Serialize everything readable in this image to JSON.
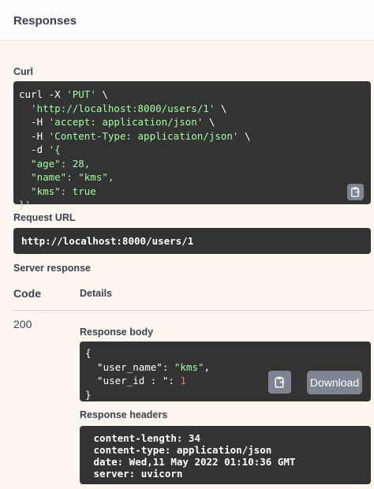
{
  "section_title": "Responses",
  "curl": {
    "label": "Curl",
    "line1_cmd": "curl -X ",
    "line1_method": "'PUT'",
    "line1_tail": " \\",
    "line2_url": "'http://localhost:8000/users/1'",
    "line2_tail": " \\",
    "line3_flag": "  -H ",
    "line3_val": "'accept: application/json'",
    "line3_tail": " \\",
    "line4_flag": "  -H ",
    "line4_val": "'Content-Type: application/json'",
    "line4_tail": " \\",
    "line5_flag": "  -d ",
    "line5_val": "'{",
    "line6": "  \"age\": 28,",
    "line7": "  \"name\": \"kms\",",
    "line8": "  \"kms\": true",
    "line9": "}'"
  },
  "request_url": {
    "label": "Request URL",
    "value": "http://localhost:8000/users/1"
  },
  "server_response": {
    "label": "Server response",
    "col_code": "Code",
    "col_details": "Details",
    "status_code": "200",
    "body_label": "Response body",
    "body_line1": "{",
    "body_key1": "  \"user_name\"",
    "body_sep1": ": ",
    "body_val1": "\"kms\"",
    "body_comma1": ",",
    "body_key2": "  \"user_id : \"",
    "body_sep2": ": ",
    "body_val2": "1",
    "body_line4": "}",
    "download_label": "Download",
    "headers_label": "Response headers",
    "headers": [
      " content-length: 34",
      " content-type: application/json",
      " date: Wed,11 May 2022 01:10:36 GMT",
      " server: uvicorn"
    ]
  },
  "icons": {
    "copy": "clipboard-copy-icon"
  }
}
